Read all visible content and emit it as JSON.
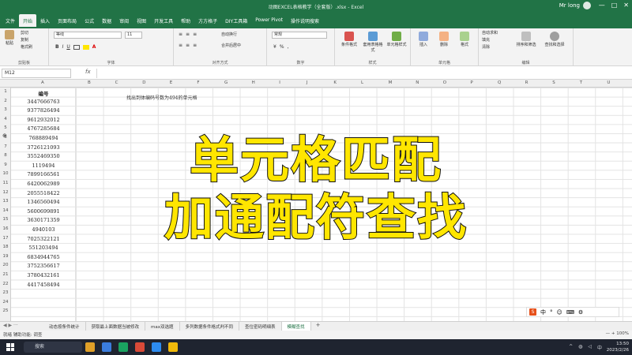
{
  "window": {
    "title": "动图EXCEL表格教学（全套版）.xlsx - Excel",
    "user": "Mr long",
    "controls": [
      "—",
      "□",
      "✕"
    ]
  },
  "ribbon_tabs": [
    "文件",
    "开始",
    "插入",
    "页面布局",
    "公式",
    "数据",
    "审阅",
    "视图",
    "开发工具",
    "帮助",
    "方方格子",
    "DIY工具箱",
    "Power Pivot",
    "操作说明搜索"
  ],
  "active_tab": "开始",
  "ribbon": {
    "clipboard": {
      "paste": "粘贴",
      "cut": "剪切",
      "copy": "复制",
      "format_painter": "格式刷",
      "label": "剪贴板"
    },
    "font": {
      "font_name": "等线",
      "font_size": "11",
      "label": "字体",
      "bold": "B",
      "italic": "I",
      "underline": "U"
    },
    "align": {
      "wrap": "自动换行",
      "merge": "合并后居中",
      "label": "对齐方式"
    },
    "number": {
      "format": "常规",
      "label": "数字"
    },
    "styles": {
      "cond": "条件格式",
      "table": "套用表格格式",
      "cell": "单元格样式",
      "label": "样式"
    },
    "cells": {
      "insert": "插入",
      "delete": "删除",
      "format": "格式",
      "label": "单元格"
    },
    "edit": {
      "autosum": "自动求和",
      "fill": "填充",
      "clear": "清除",
      "sort": "排序和筛选",
      "find": "查找和选择",
      "label": "编辑"
    }
  },
  "formula_bar": {
    "name_box": "M12",
    "fx": "fx",
    "value": ""
  },
  "columns": [
    "A",
    "B",
    "C",
    "D",
    "E",
    "F",
    "G",
    "H",
    "I",
    "J",
    "K",
    "L",
    "M",
    "N",
    "O",
    "P",
    "Q",
    "R",
    "S",
    "T",
    "U",
    "V",
    "W"
  ],
  "rows": [
    "1",
    "2",
    "3",
    "4",
    "5",
    "6",
    "7",
    "8",
    "9",
    "10",
    "11",
    "12",
    "13",
    "14",
    "15",
    "16",
    "17",
    "18",
    "19",
    "20",
    "21",
    "22",
    "23",
    "24",
    "25"
  ],
  "column_a": {
    "header": "编号",
    "values": [
      "3447666763",
      "9377826494",
      "9612932012",
      "4767285684",
      "768889494",
      "3726121093",
      "3552469350",
      "1119494",
      "7899166561",
      "6420062989",
      "2055518422",
      "1346560494",
      "5600699891",
      "3630171359",
      "4940103",
      "7025322121",
      "551203494",
      "6834944765",
      "3752356617",
      "3780432161",
      "4417458494"
    ]
  },
  "note_text": "找出到体编码号数为494的单元格",
  "overlay": {
    "line1": "单元格匹配",
    "line2": "加通配符查找"
  },
  "sheet_tabs": [
    "动态按条件统计",
    "获取最上面数据当被修改",
    "max双选题",
    "多列数据条件格式判不同",
    "查位密码明细表",
    "模糊查找"
  ],
  "active_sheet": "模糊查找",
  "sheet_add": "+",
  "status": {
    "left": "就绪   辅助功能: 调查",
    "right": "—  +  100%"
  },
  "taskbar": {
    "search_text": "搜索",
    "clock_time": "13:50",
    "clock_date": "2023/2/26",
    "icon_colors": [
      "#e0a028",
      "#3b7ddd",
      "#1aa260",
      "#d94a38",
      "#2d8cf0",
      "#f0b90b"
    ]
  }
}
